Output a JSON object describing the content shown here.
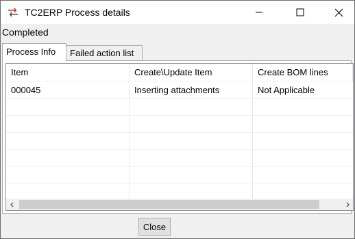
{
  "window": {
    "title": "TC2ERP Process details",
    "icon": "arrows-exchange-icon"
  },
  "status": "Completed",
  "tabs": [
    {
      "label": "Process Info",
      "selected": true
    },
    {
      "label": "Failed action list",
      "selected": false
    }
  ],
  "table": {
    "columns": [
      "Item",
      "Create\\Update Item",
      "Create BOM lines"
    ],
    "rows": [
      [
        "000045",
        "Inserting attachments",
        "Not Applicable"
      ]
    ]
  },
  "buttons": {
    "close_label": "Close"
  },
  "colors": {
    "accent_red": "#c0392b",
    "titlebar": "#ffffff",
    "window_bg": "#f0f0f0"
  }
}
